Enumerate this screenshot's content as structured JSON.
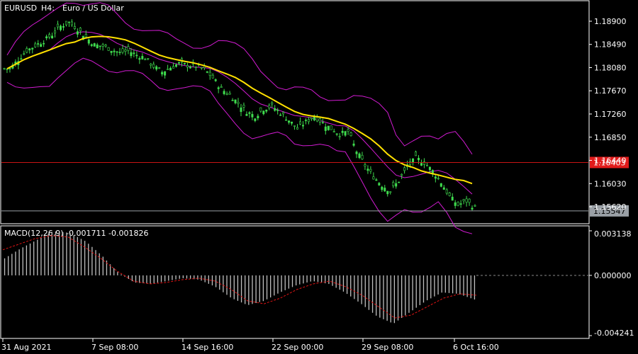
{
  "main_panel": {
    "symbol": "EURUSD",
    "timeframe": "H4:",
    "description": "Euro / US Dollar",
    "price_ticks": [
      "1.18900",
      "1.18490",
      "1.18080",
      "1.17670",
      "1.17260",
      "1.16850",
      "1.16440",
      "1.16030",
      "1.15620"
    ],
    "red_line_label": "1.16403",
    "bid_label": "1.15547",
    "colors": {
      "candle": "#3fdc4e",
      "ma": "#ffe000",
      "bands": "#d21bd2",
      "red_line": "#c81414",
      "bid_line": "#9aa0a6",
      "bid_box": "#9aa0a6",
      "red_box": "#e11b1b"
    }
  },
  "macd_panel": {
    "title": "MACD(12,26,9) -0.001711 -0.001826",
    "ticks": [
      "0.003138",
      "0.000000",
      "-0.004241"
    ],
    "colors": {
      "hist": "#c0c0c0",
      "signal": "#e01414"
    }
  },
  "time_axis": {
    "labels": [
      "31 Aug 2021",
      "7 Sep 08:00",
      "14 Sep 16:00",
      "22 Sep 00:00",
      "29 Sep 08:00",
      "6 Oct 16:00"
    ]
  },
  "chart_data": {
    "type": "candlestick",
    "series": [
      {
        "name": "EURUSD",
        "values": [
          1.1806,
          1.1822,
          1.1838,
          1.1847,
          1.1855,
          1.1866,
          1.1881,
          1.1888,
          1.1876,
          1.1862,
          1.1848,
          1.1846,
          1.184,
          1.1834,
          1.1838,
          1.183,
          1.1825,
          1.181,
          1.18,
          1.1808,
          1.1815,
          1.1812,
          1.181,
          1.1805,
          1.179,
          1.177,
          1.176,
          1.1745,
          1.173,
          1.1722,
          1.1735,
          1.174,
          1.1728,
          1.1715,
          1.17,
          1.1712,
          1.1722,
          1.171,
          1.17,
          1.169,
          1.1695,
          1.166,
          1.1635,
          1.1615,
          1.16,
          1.159,
          1.1608,
          1.1632,
          1.1648,
          1.164,
          1.1625,
          1.1605,
          1.158,
          1.1565,
          1.1572,
          1.156
        ]
      }
    ],
    "signal_values": [
      0.0018,
      0.0022,
      0.0026,
      0.0028,
      0.0027,
      0.002,
      0.0012,
      0.0003,
      -0.0004,
      -0.0006,
      -0.0005,
      -0.0003,
      -0.0002,
      -0.0004,
      -0.001,
      -0.0018,
      -0.002,
      -0.0016,
      -0.001,
      -0.0006,
      -0.0004,
      -0.0008,
      -0.0014,
      -0.0022,
      -0.003,
      -0.0028,
      -0.0022,
      -0.0016,
      -0.0013,
      -0.0014
    ],
    "hist_values": [
      0.0012,
      0.0019,
      0.0025,
      0.0031,
      0.003,
      0.0024,
      0.0014,
      0.0002,
      -0.0005,
      -0.0006,
      -0.0004,
      -0.0002,
      -0.0003,
      -0.0008,
      -0.0016,
      -0.0021,
      -0.0018,
      -0.0012,
      -0.0007,
      -0.0004,
      -0.0006,
      -0.0012,
      -0.002,
      -0.0029,
      -0.0034,
      -0.0026,
      -0.0018,
      -0.0012,
      -0.0013,
      -0.0017
    ],
    "ylim": [
      1.1537,
      1.191
    ],
    "macd_ylim": [
      -0.004241,
      0.003138
    ]
  }
}
